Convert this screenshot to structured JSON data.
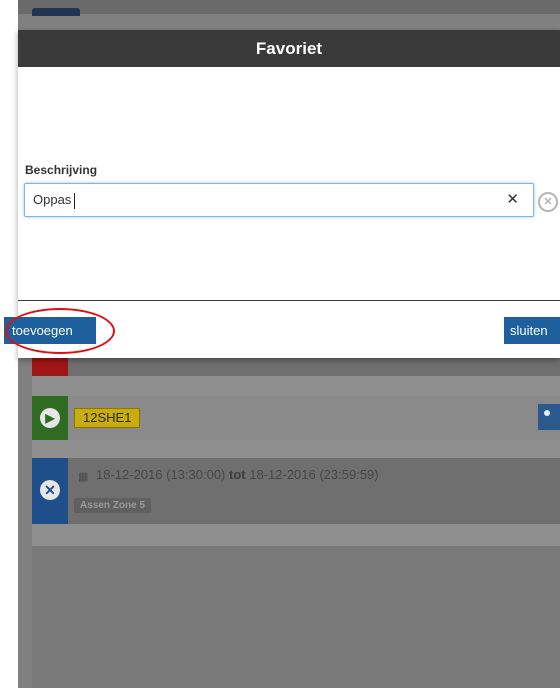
{
  "modal": {
    "title": "Favoriet",
    "field_label": "Beschrijving",
    "input_value": "Oppas",
    "add_label": "toevoegen",
    "close_label": "sluiten"
  },
  "background": {
    "plate": "12SHE1",
    "date_start": "18-12-2016 (13:30:00)",
    "date_sep": "tot",
    "date_end": "18-12-2016 (23:59:59)",
    "zone": "Assen Zone 5"
  },
  "colors": {
    "header_bg": "#3a3a3a",
    "primary_button": "#1e5f9e",
    "annotation_ring": "#e01010",
    "plate_yellow": "#c8ac10"
  },
  "icons": {
    "clear": "close-icon",
    "outer_clear": "circle-x-icon",
    "play": "play-circle-icon",
    "remove": "x-circle-icon",
    "calendar": "calendar-icon",
    "tag": "tag-icon"
  }
}
